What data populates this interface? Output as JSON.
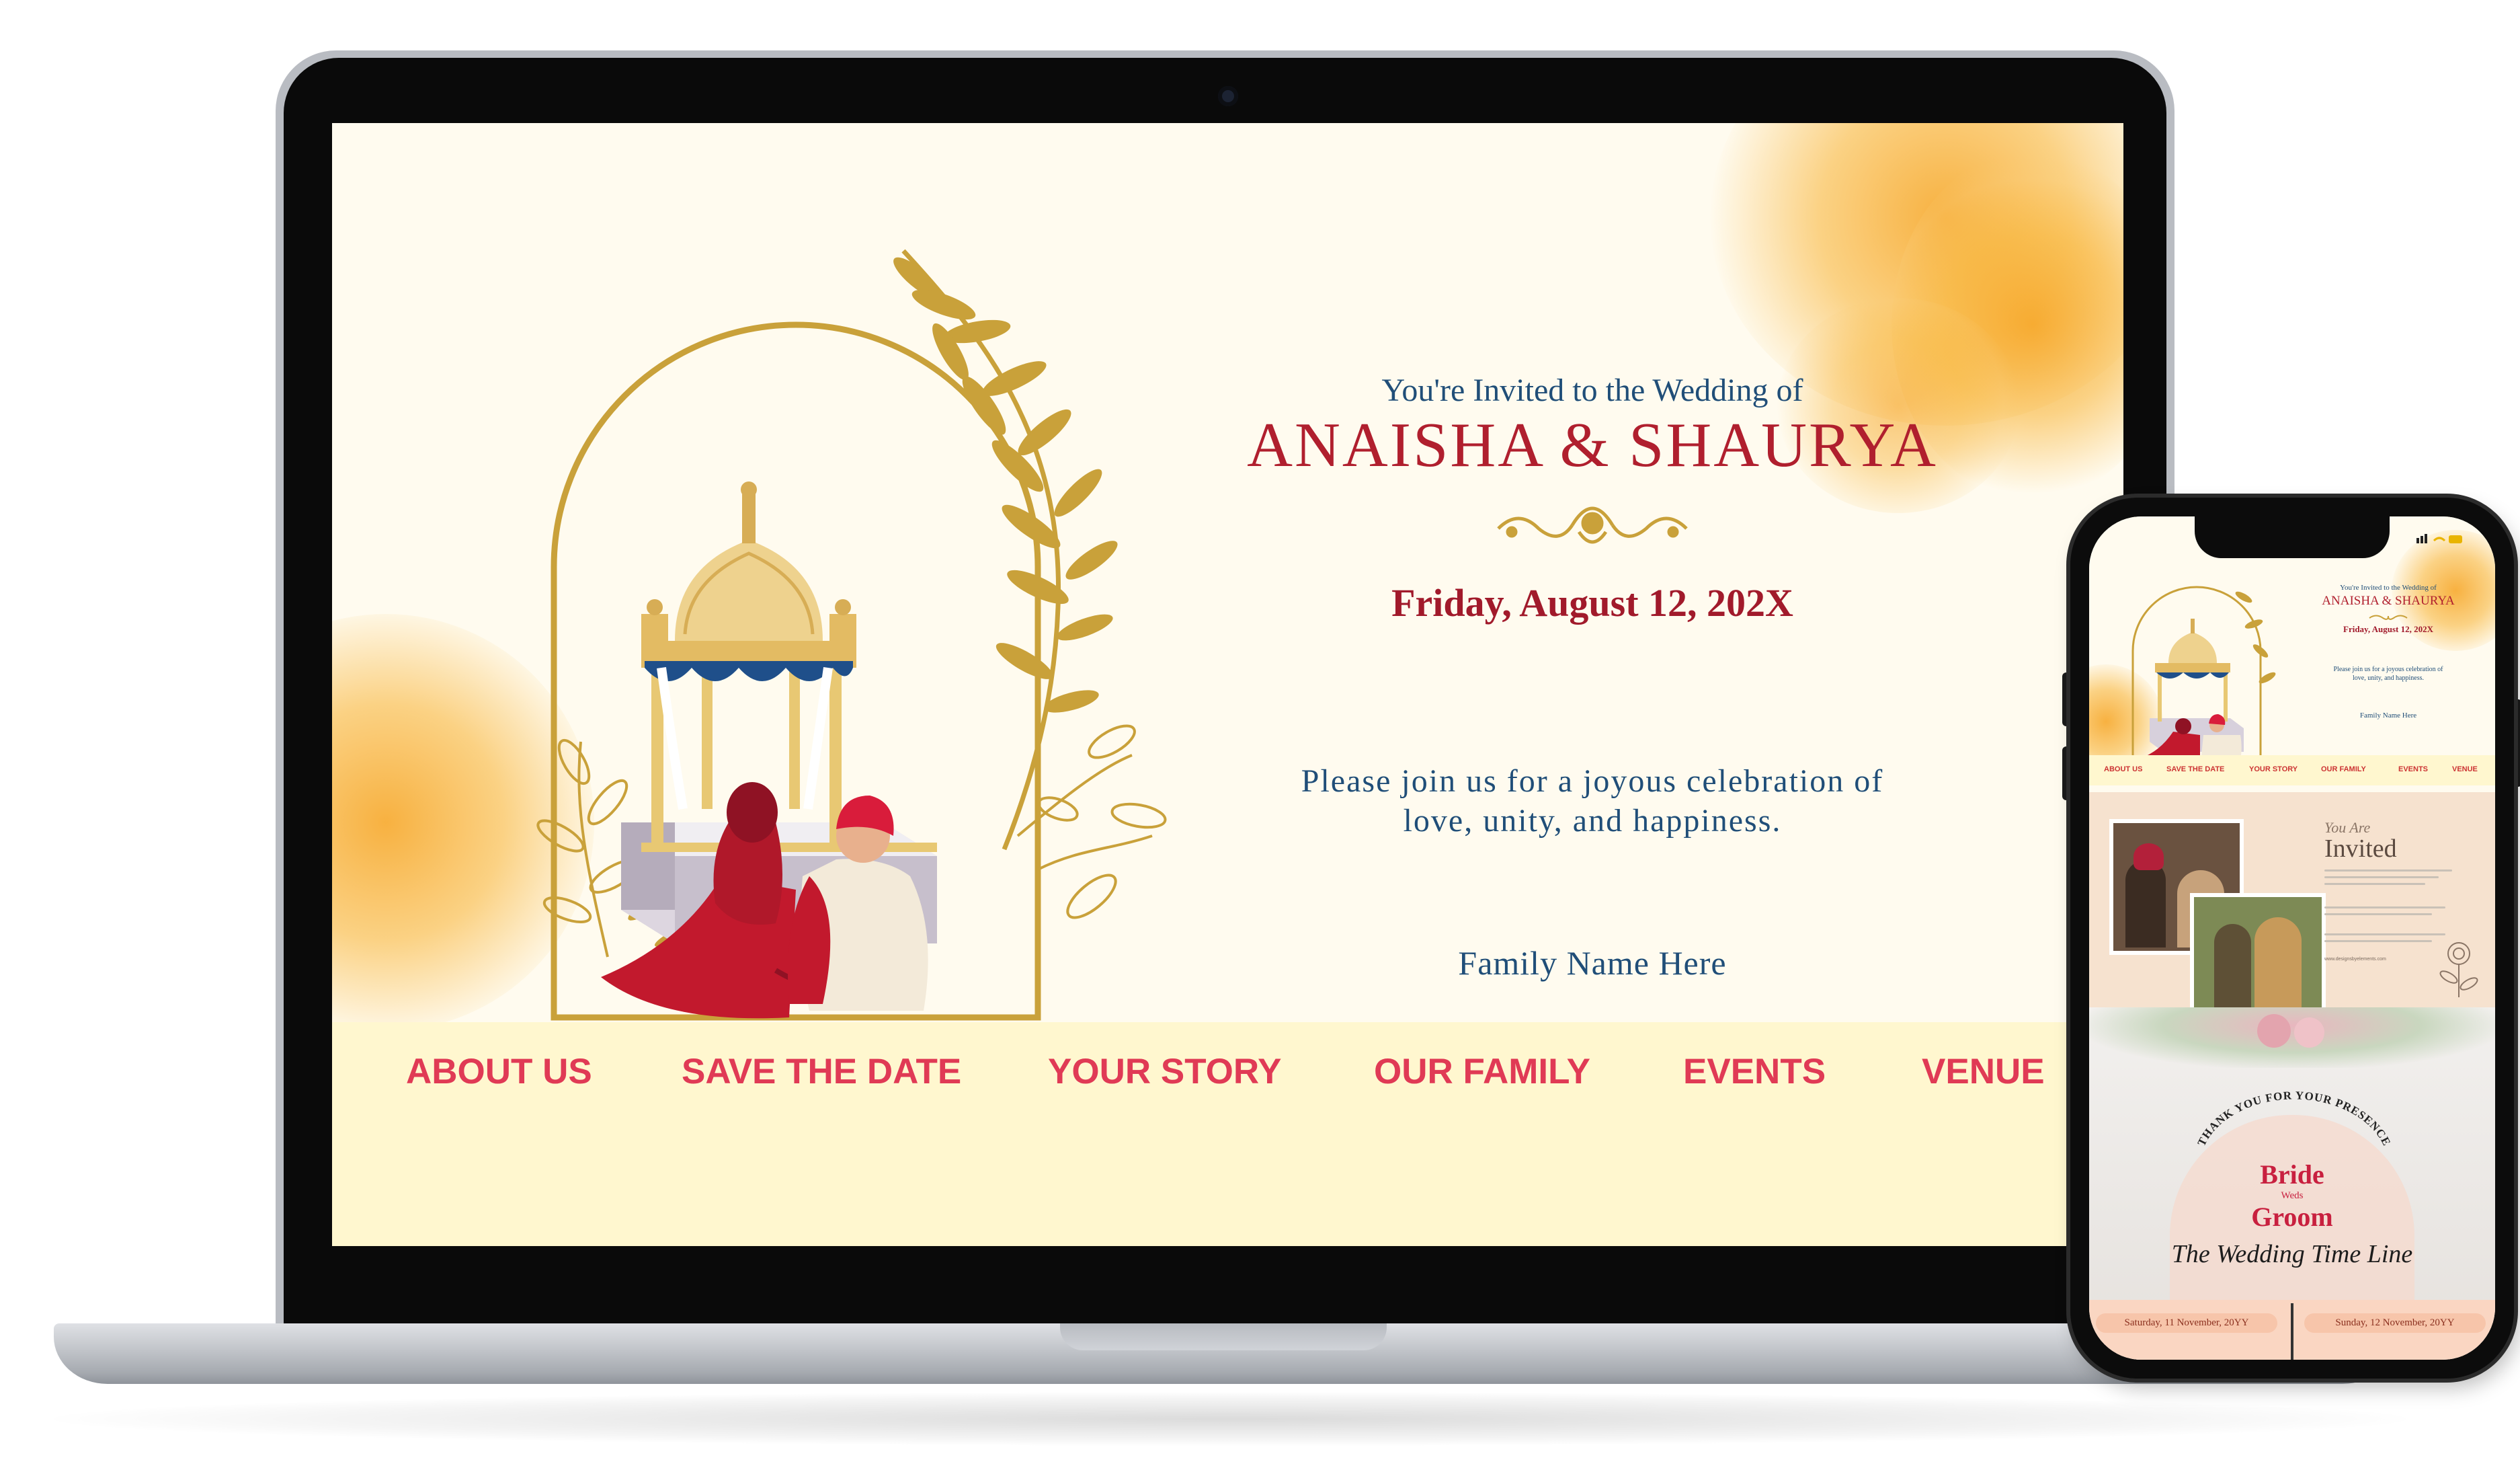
{
  "desktop": {
    "hero": {
      "invite_line": "You're Invited to the Wedding of",
      "couple_names": "ANAISHA & SHAURYA",
      "date": "Friday, August 12, 202X",
      "message_line1": "Please join us for a joyous celebration of",
      "message_line2": "love, unity, and happiness.",
      "family": "Family Name Here"
    },
    "nav": [
      {
        "label": "ABOUT US"
      },
      {
        "label": "SAVE THE DATE"
      },
      {
        "label": "YOUR STORY"
      },
      {
        "label": "OUR FAMILY"
      },
      {
        "label": "EVENTS"
      },
      {
        "label": "VENUE"
      }
    ]
  },
  "mobile": {
    "hero": {
      "invite_line": "You're Invited to the Wedding of",
      "couple_names": "ANAISHA & SHAURYA",
      "date": "Friday, August 12, 202X",
      "message_line1": "Please join us for a joyous celebration of",
      "message_line2": "love, unity, and happiness.",
      "family": "Family Name Here"
    },
    "nav": [
      {
        "label": "ABOUT US"
      },
      {
        "label": "SAVE THE DATE"
      },
      {
        "label": "YOUR STORY"
      },
      {
        "label": "OUR FAMILY"
      },
      {
        "label": "EVENTS"
      },
      {
        "label": "VENUE"
      }
    ],
    "invited": {
      "script": "You Are",
      "title": "Invited",
      "website": "www.designsbyelements.com"
    },
    "timeline": {
      "arc_text": "THANK YOU FOR YOUR PRESENCE",
      "bride": "Bride",
      "weds": "Weds",
      "groom": "Groom",
      "title": "The Wedding Time Line",
      "date1": "Saturday, 11 November, 20YY",
      "date2": "Sunday, 12 November, 20YY"
    }
  },
  "colors": {
    "accent_red": "#b01f2e",
    "nav_pink": "#e03a55",
    "text_blue": "#204e78",
    "gold": "#c9a13a",
    "cream": "#fffbef",
    "nav_bg": "#fff7cf"
  }
}
